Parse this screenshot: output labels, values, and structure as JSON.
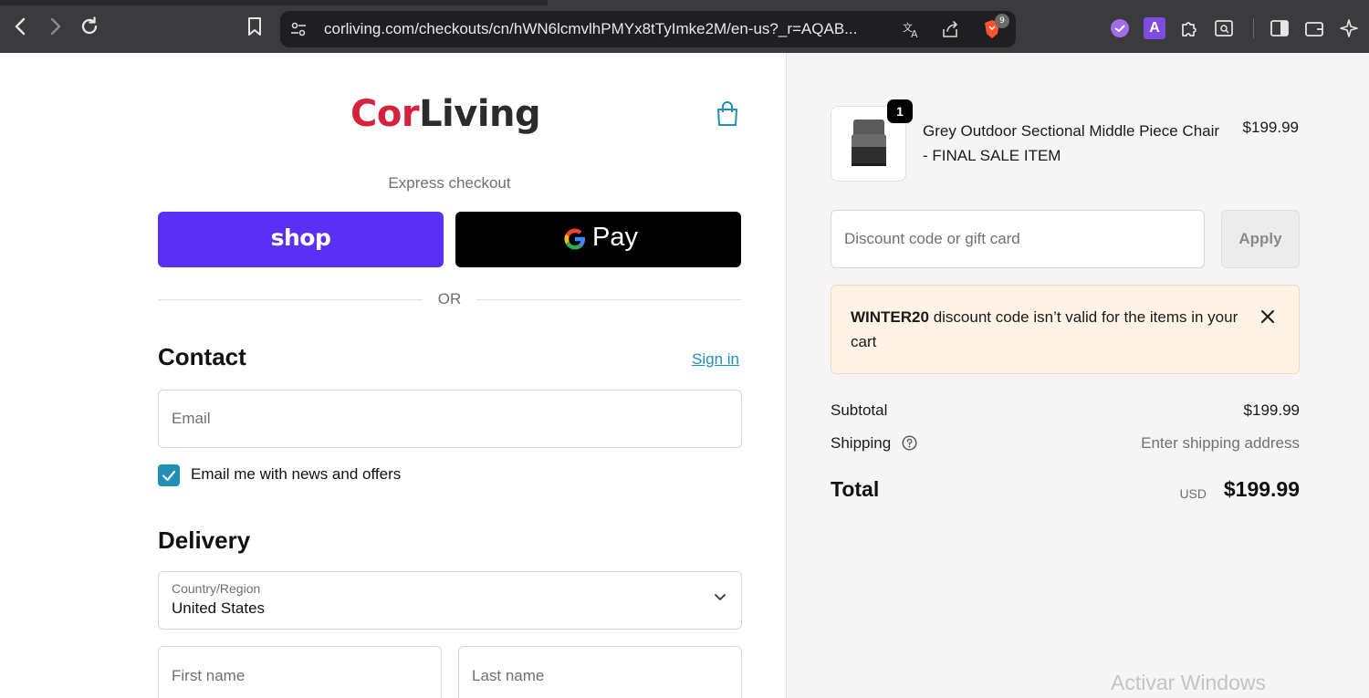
{
  "browser": {
    "url": "corliving.com/checkouts/cn/hWN6lcmvlhPMYx8tTyImke2M/en-us?_r=AQAB...",
    "shield_count": "9",
    "ext_letter": "A"
  },
  "brand": {
    "name_part1": "Cor",
    "name_part2": "Living",
    "primary_color": "#d6213c",
    "accent_color": "#1f8fb8"
  },
  "express": {
    "label": "Express checkout",
    "shop_label": "shop",
    "gpay_label": "Pay",
    "or_label": "OR"
  },
  "contact": {
    "title": "Contact",
    "sign_in_label": "Sign in",
    "email_placeholder": "Email",
    "newsletter_label": "Email me with news and offers",
    "newsletter_checked": true
  },
  "delivery": {
    "title": "Delivery",
    "country_label": "Country/Region",
    "country_value": "United States",
    "first_name_placeholder": "First name",
    "last_name_placeholder": "Last name"
  },
  "cart": {
    "item": {
      "name": "Grey Outdoor Sectional Middle Piece Chair - FINAL SALE ITEM",
      "price": "$199.99",
      "quantity": "1"
    },
    "discount_placeholder": "Discount code or gift card",
    "apply_label": "Apply",
    "alert": {
      "code": "WINTER20",
      "message": "discount code isn’t valid for the items in your cart"
    },
    "subtotal_label": "Subtotal",
    "subtotal_value": "$199.99",
    "shipping_label": "Shipping",
    "shipping_value": "Enter shipping address",
    "total_label": "Total",
    "total_currency": "USD",
    "total_value": "$199.99"
  },
  "watermark": "Activar Windows"
}
